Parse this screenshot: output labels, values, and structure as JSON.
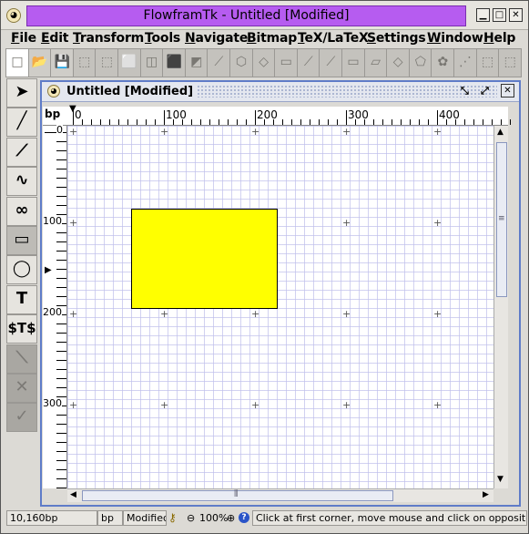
{
  "window": {
    "title": "FlowframTk - Untitled [Modified]"
  },
  "menu": [
    "File",
    "Edit",
    "Transform",
    "Tools",
    "Navigate",
    "Bitmap",
    "TeX/LaTeX",
    "Settings",
    "Window",
    "Help"
  ],
  "toolbar_icons": [
    "new-icon",
    "open-icon",
    "save-icon",
    "select-all-icon",
    "deselect-icon",
    "group-icon",
    "ungroup-icon",
    "back-icon",
    "front-icon",
    "path-edit-icon",
    "convert-path-icon",
    "merge-path-icon",
    "reduce-icon",
    "split-icon",
    "sign-icon",
    "rotate-icon",
    "scale-icon",
    "shear-icon",
    "envelope-icon",
    "pattern-icon",
    "distort-icon",
    "grid-icon",
    "snap-icon"
  ],
  "tools": [
    "select-tool",
    "open-line-tool",
    "closed-line-tool",
    "open-curve-tool",
    "closed-curve-tool",
    "rectangle-tool",
    "ellipse-tool",
    "text-tool",
    "math-text-tool",
    "disabled-1",
    "disabled-2",
    "disabled-3"
  ],
  "tool_glyphs": {
    "text": "T",
    "math": "$T$"
  },
  "document": {
    "title": "Untitled [Modified]",
    "ruler_unit": "bp",
    "h_ticks": [
      "0",
      "100",
      "200",
      "300",
      "400"
    ],
    "v_ticks": [
      "0",
      "100",
      "200",
      "300"
    ],
    "shape": {
      "type": "rectangle",
      "fill": "#ffff00",
      "stroke": "#000000"
    }
  },
  "status": {
    "coords": "10,160bp",
    "unit": "bp",
    "modified": "Modified",
    "zoom": "100%",
    "message": "Click at first corner, move mouse and click on opposite corner"
  },
  "colors": {
    "title_bar": "#b65cf0",
    "frame_border": "#5f7cc8",
    "shape_fill": "#ffff00"
  }
}
